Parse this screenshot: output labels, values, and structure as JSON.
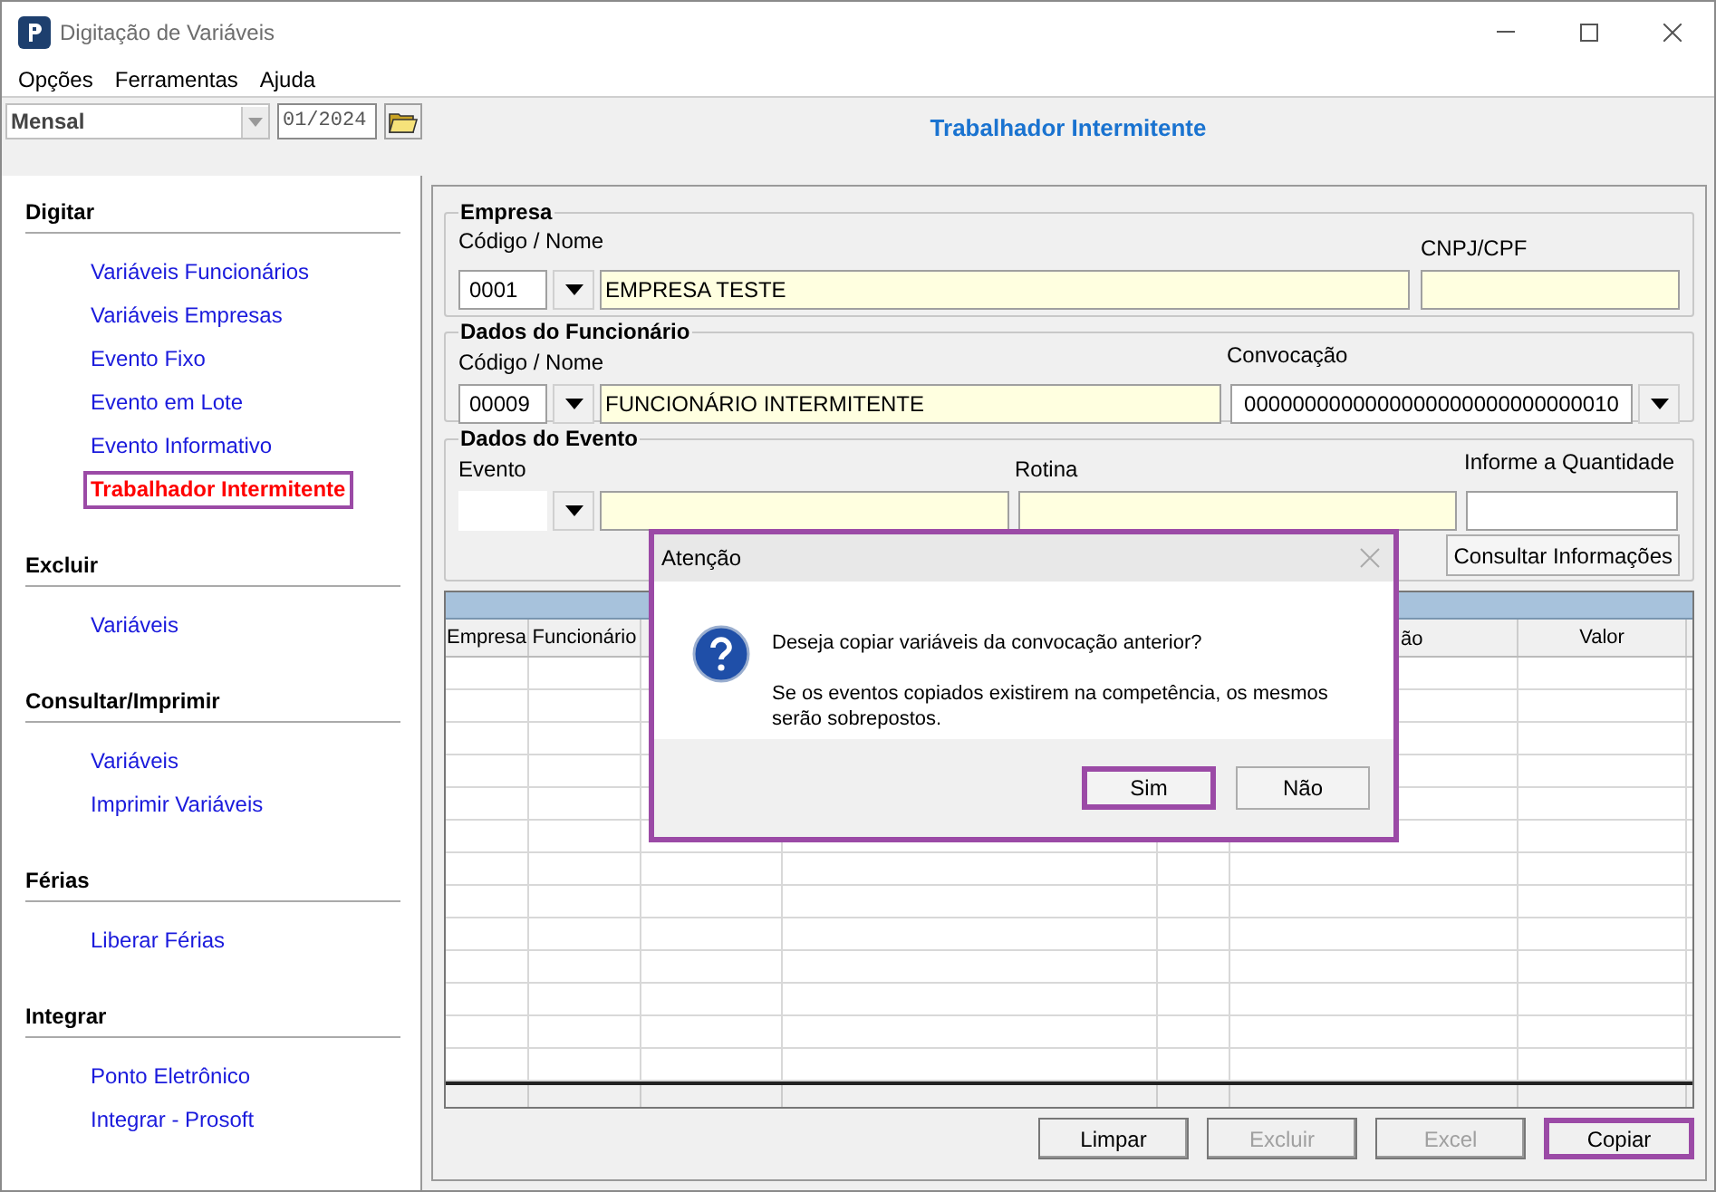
{
  "window": {
    "title": "Digitação de Variáveis"
  },
  "menu": [
    "Opções",
    "Ferramentas",
    "Ajuda"
  ],
  "toolbar": {
    "period_type": "Mensal",
    "competence": "01/2024"
  },
  "page_title": "Trabalhador Intermitente",
  "sidebar": [
    {
      "heading": "Digitar",
      "items": [
        {
          "label": "Variáveis Funcionários",
          "selected": false
        },
        {
          "label": "Variáveis Empresas",
          "selected": false
        },
        {
          "label": "Evento Fixo",
          "selected": false
        },
        {
          "label": "Evento em Lote",
          "selected": false
        },
        {
          "label": "Evento Informativo",
          "selected": false
        },
        {
          "label": "Trabalhador Intermitente",
          "selected": true
        }
      ]
    },
    {
      "heading": "Excluir",
      "items": [
        {
          "label": "Variáveis",
          "selected": false
        }
      ]
    },
    {
      "heading": "Consultar/Imprimir",
      "items": [
        {
          "label": "Variáveis",
          "selected": false
        },
        {
          "label": "Imprimir Variáveis",
          "selected": false
        }
      ]
    },
    {
      "heading": "Férias",
      "items": [
        {
          "label": "Liberar Férias",
          "selected": false
        }
      ]
    },
    {
      "heading": "Integrar",
      "items": [
        {
          "label": "Ponto Eletrônico",
          "selected": false
        },
        {
          "label": "Integrar - Prosoft",
          "selected": false
        }
      ]
    }
  ],
  "empresa": {
    "legend": "Empresa",
    "code_label": "Código / Nome",
    "code": "0001",
    "name": "EMPRESA TESTE",
    "cnpj_label": "CNPJ/CPF"
  },
  "funcionario": {
    "legend": "Dados do Funcionário",
    "code_label": "Código / Nome",
    "code": "00009",
    "name": "FUNCIONÁRIO INTERMITENTE",
    "convocacao_label": "Convocação",
    "convocacao": "0000000000000000000000000000010"
  },
  "evento": {
    "legend": "Dados do Evento",
    "evento_label": "Evento",
    "rotina_label": "Rotina",
    "quantidade_label": "Informe a Quantidade",
    "button": "Consultar Informações"
  },
  "table": {
    "column_1": "Empresa",
    "column_2": "Funcionário",
    "column_6": "ão",
    "column_7": "Valor"
  },
  "buttons": [
    {
      "label": "Limpar",
      "disabled": false,
      "highlighted": false
    },
    {
      "label": "Excluir",
      "disabled": true,
      "highlighted": false
    },
    {
      "label": "Excel",
      "disabled": true,
      "highlighted": false
    },
    {
      "label": "Copiar",
      "disabled": false,
      "highlighted": true
    }
  ],
  "dialog": {
    "title": "Atenção",
    "message": "Deseja copiar variáveis da convocação anterior?",
    "detail": "Se os eventos copiados existirem na competência, os mesmos serão sobrepostos.",
    "highlighted": true,
    "buttons": [
      {
        "label": "Sim",
        "highlighted": true
      },
      {
        "label": "Não",
        "highlighted": false
      }
    ]
  }
}
